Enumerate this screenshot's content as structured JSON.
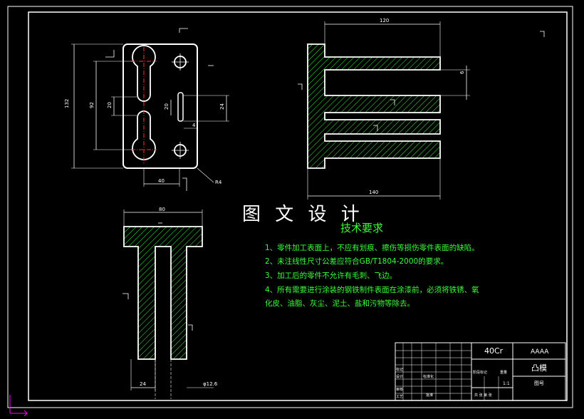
{
  "drawing": {
    "watermark": "图 文 设 计",
    "requirements_title": "技术要求",
    "requirements": [
      "1、零件加工表面上，不应有划痕、擦伤等损伤零件表面的缺陷。",
      "2、未注线性尺寸公差应符合GB/T1804-2000的要求。",
      "3、加工后的零件不允许有毛刺、飞边。",
      "4、所有需要进行涂装的钢铁制件表面在涂漆前，必须将铁锈、氧",
      "化皮、油脂、灰尘、泥土、盐和污物等除去。"
    ],
    "dimensions": {
      "front_height": "132",
      "front_slot_span": "92",
      "front_slot_width": "20",
      "front_hole_spacing": "20",
      "front_width_right": "24",
      "front_gap": "4",
      "front_bottom_width": "40",
      "front_radius": "R4",
      "side_top_width": "120",
      "side_bottom_width": "140",
      "side_thickness": "6",
      "bottom_top_width": "80",
      "bottom_leg_width": "24",
      "bottom_diameter": "φ12.6"
    },
    "title_block": {
      "material": "40Cr",
      "company": "AAAA",
      "part_name": "凸模",
      "drawing_no_label": "图号",
      "scale": "1:1",
      "label_mark": "标记",
      "label_design": "设计",
      "label_review": "审核",
      "label_standard": "标准化",
      "label_process": "工艺",
      "label_approve": "批准",
      "label_stage": "阶段标记",
      "label_weight": "重量",
      "label_ratio": "比例",
      "label_sheets": "共  张  第  张"
    },
    "colors": {
      "outline": "#ffffff",
      "hatch": "#39ff39",
      "dimension": "#ffffff",
      "border": "#ffffff",
      "accent": "#ff00ff"
    }
  }
}
